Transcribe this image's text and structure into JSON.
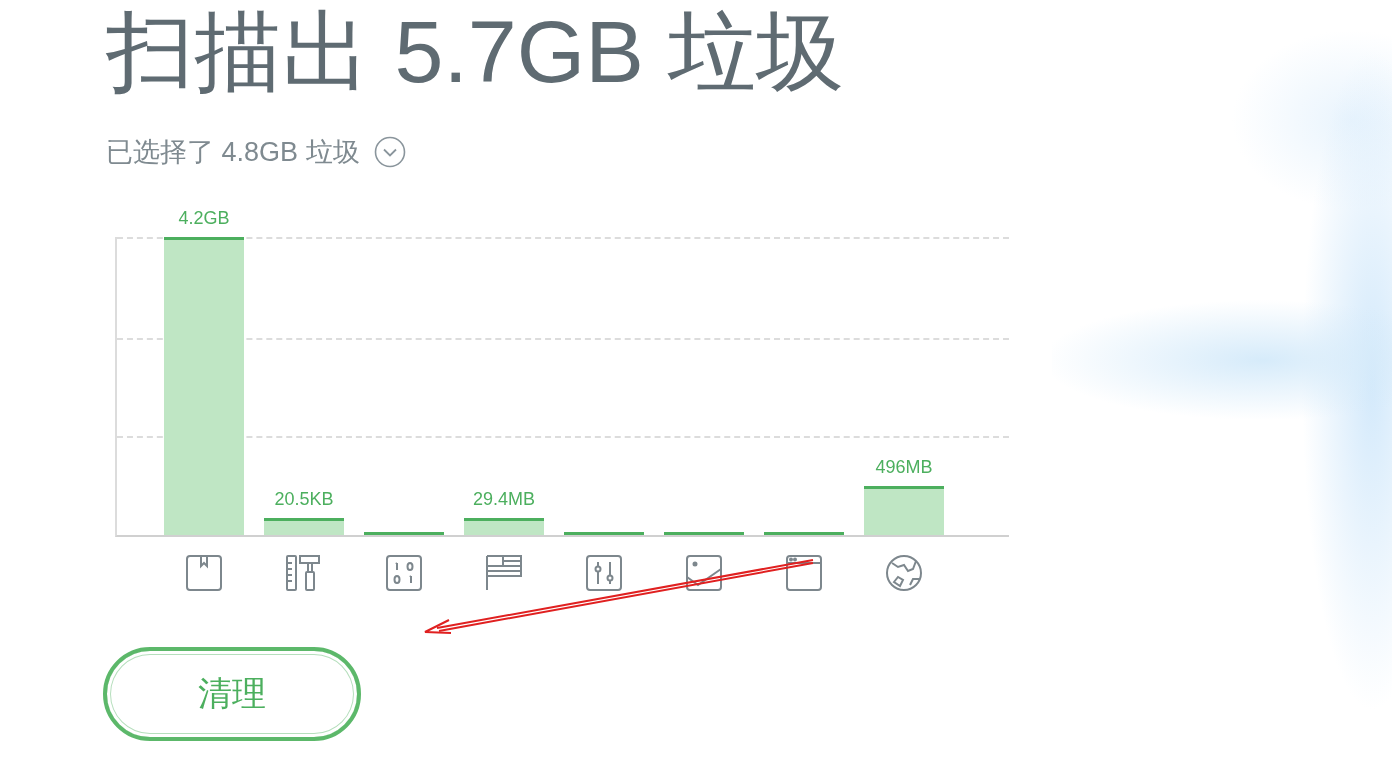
{
  "title": "扫描出 5.7GB 垃圾",
  "subtitle": "已选择了 4.8GB 垃圾",
  "bars": [
    {
      "kind": "package",
      "value_label": "4.2GB",
      "level": 1
    },
    {
      "kind": "tools",
      "value_label": "20.5KB",
      "level": 0.057
    },
    {
      "kind": "binary",
      "level": 0.01
    },
    {
      "kind": "flag",
      "value_label": "29.4MB",
      "level": 0.057
    },
    {
      "kind": "sliders",
      "level": 0.01
    },
    {
      "kind": "image",
      "level": 0.01
    },
    {
      "kind": "window",
      "level": 0.01
    },
    {
      "kind": "globe",
      "value_label": "496MB",
      "level": 0.165
    }
  ],
  "clean_button": "清理"
}
